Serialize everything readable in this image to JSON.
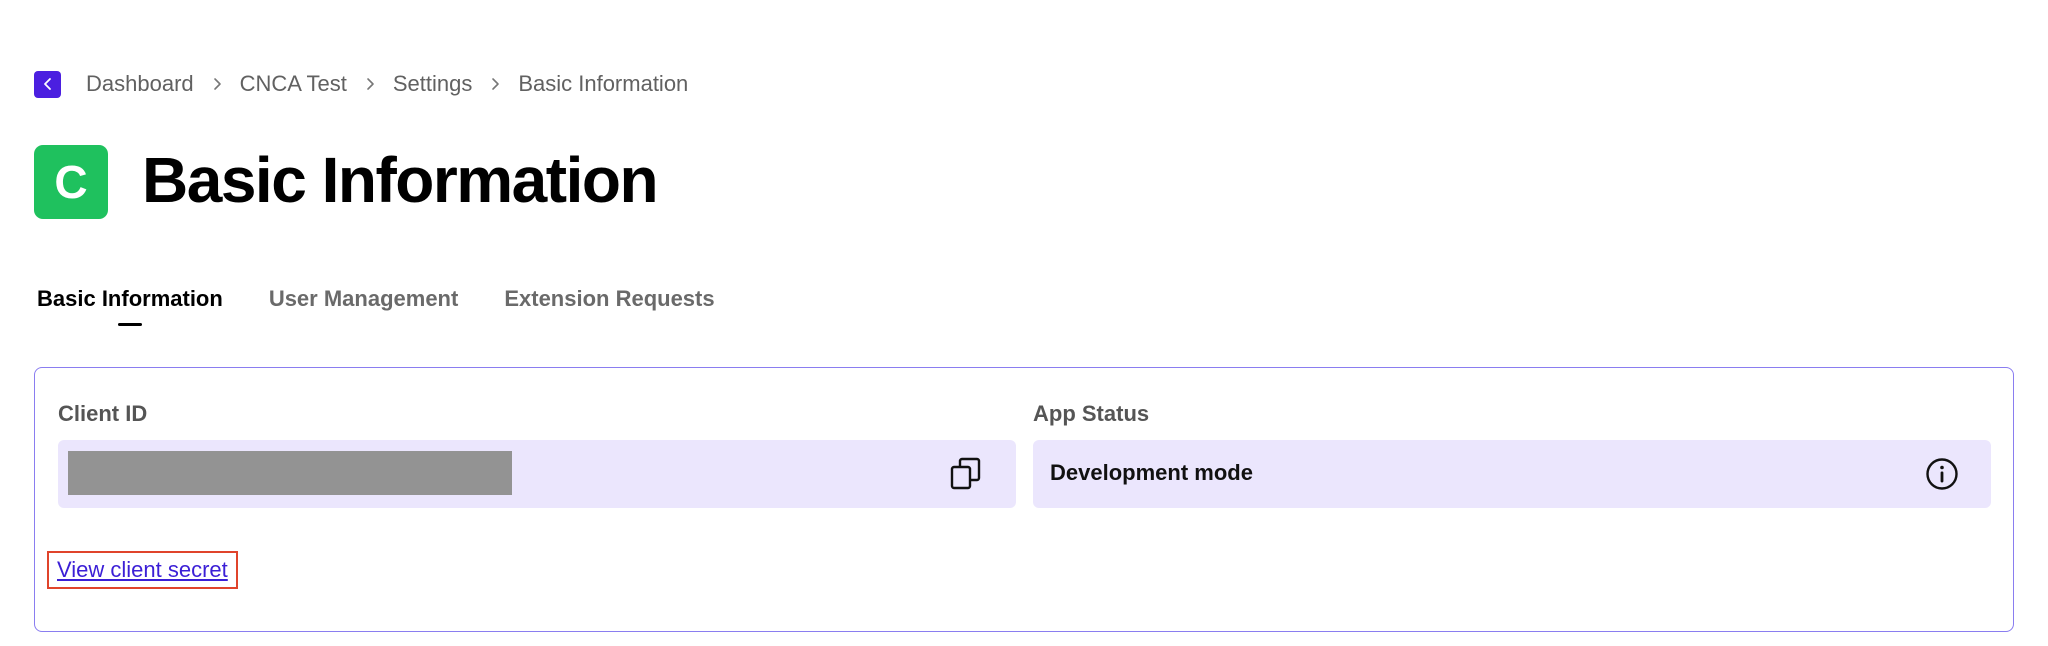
{
  "breadcrumb": {
    "items": [
      "Dashboard",
      "CNCA Test",
      "Settings",
      "Basic Information"
    ]
  },
  "header": {
    "avatar_letter": "C",
    "title": "Basic Information"
  },
  "tabs": [
    {
      "label": "Basic Information",
      "active": true
    },
    {
      "label": "User Management",
      "active": false
    },
    {
      "label": "Extension Requests",
      "active": false
    }
  ],
  "card": {
    "client_id": {
      "label": "Client ID",
      "value_redacted": true
    },
    "app_status": {
      "label": "App Status",
      "value": "Development mode"
    },
    "view_secret_label": "View client secret"
  },
  "colors": {
    "brand": "#4b1fe0",
    "avatar": "#1fc15e",
    "field_bg": "#ebe6fd",
    "card_border": "#8a7df0",
    "highlight": "#e0442b"
  },
  "icons": [
    "chevron-left-icon",
    "chevron-right-icon",
    "copy-icon",
    "info-icon"
  ]
}
